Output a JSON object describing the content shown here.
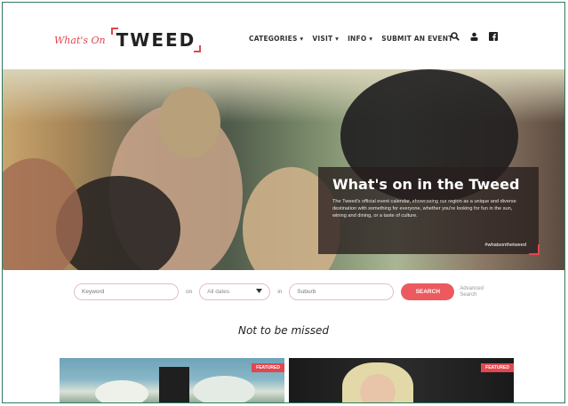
{
  "header": {
    "logo_script": "What's On",
    "logo_main": "TWEED",
    "nav": [
      "CATEGORIES ▾",
      "VISIT ▾",
      "INFO ▾",
      "SUBMIT AN EVENT"
    ],
    "icons": [
      "search-icon",
      "user-icon",
      "facebook-icon"
    ]
  },
  "hero": {
    "title": "What's on in the Tweed",
    "text": "The Tweed's official event calendar, showcasing our region as a unique and diverse destination with something for everyone, whether you're looking for fun in the sun, wining and dining, or a taste of culture.",
    "tag": "#whatsonthetweed"
  },
  "search": {
    "keyword_placeholder": "Keyword",
    "on_label": "on",
    "dates_value": "All dates",
    "in_label": "in",
    "suburb_placeholder": "Suburb",
    "button": "SEARCH",
    "advanced": "Advanced Search"
  },
  "section": {
    "title": "Not to be missed"
  },
  "cards": [
    {
      "badge": "FEATURED"
    },
    {
      "badge": "FEATURED"
    }
  ],
  "colors": {
    "accent": "#e0474f",
    "button": "#ec5a60"
  }
}
